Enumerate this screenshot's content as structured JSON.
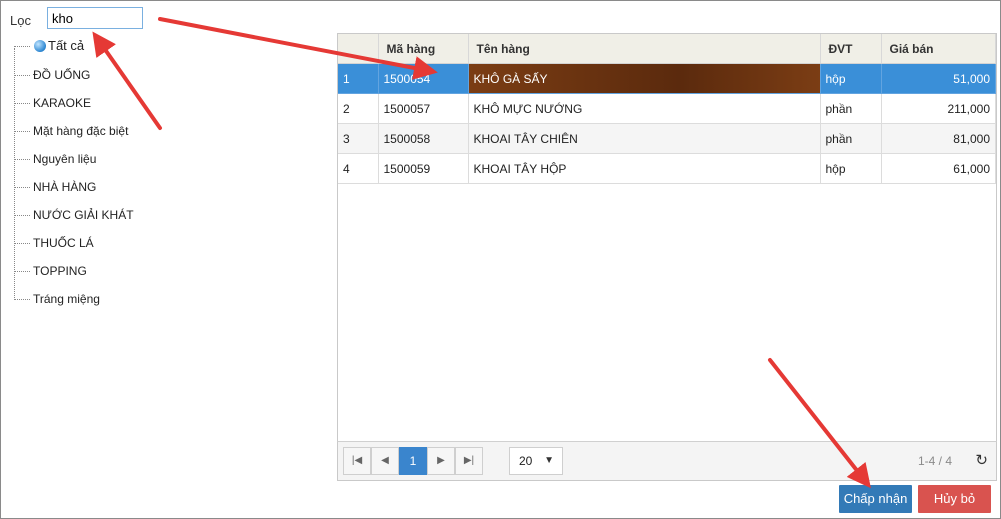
{
  "filter": {
    "label": "Lọc",
    "value": "kho"
  },
  "tree": {
    "root": "Tất cả",
    "items": [
      "ĐỒ UỐNG",
      "KARAOKE",
      "Mặt hàng đặc biệt",
      "Nguyên liệu",
      "NHÀ HÀNG",
      "NƯỚC GIẢI KHÁT",
      "THUỐC LÁ",
      "TOPPING",
      "Tráng miệng"
    ]
  },
  "grid": {
    "columns": [
      "",
      "Mã hàng",
      "Tên hàng",
      "ĐVT",
      "Giá bán"
    ],
    "rows": [
      {
        "idx": "1",
        "code": "1500054",
        "name": "KHÔ GÀ SẤY",
        "unit": "hộp",
        "price": "51,000"
      },
      {
        "idx": "2",
        "code": "1500057",
        "name": "KHÔ MỰC NƯỚNG",
        "unit": "phần",
        "price": "211,000"
      },
      {
        "idx": "3",
        "code": "1500058",
        "name": "KHOAI TÂY CHIÊN",
        "unit": "phần",
        "price": "81,000"
      },
      {
        "idx": "4",
        "code": "1500059",
        "name": "KHOAI TÂY HỘP",
        "unit": "hộp",
        "price": "61,000"
      }
    ]
  },
  "pager": {
    "current": "1",
    "page_size": "20",
    "info": "1-4 / 4"
  },
  "buttons": {
    "ok": "Chấp nhận",
    "cancel": "Hủy bỏ"
  },
  "colors": {
    "accent": "#3a8fd8",
    "ok": "#337ab7",
    "cancel": "#d9534f",
    "arrow": "#e53935"
  }
}
